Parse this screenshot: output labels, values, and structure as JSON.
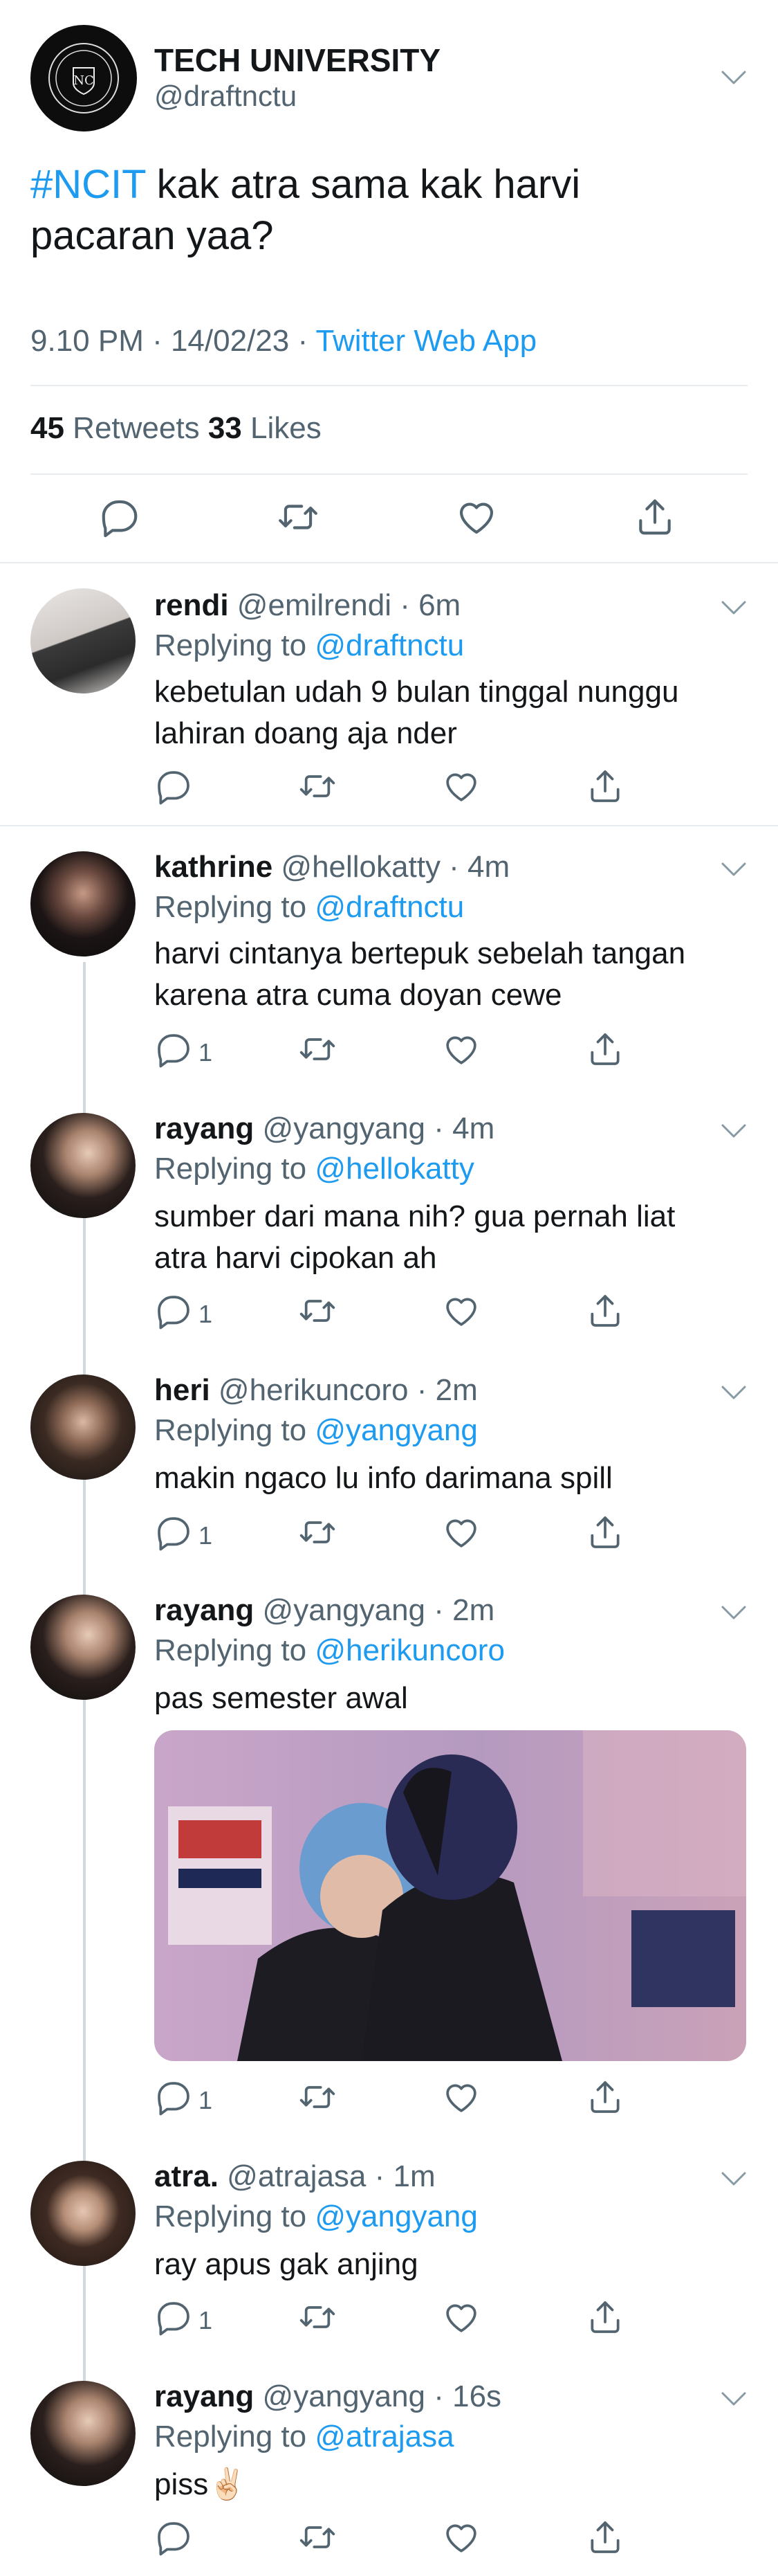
{
  "main": {
    "name": "TECH UNIVERSITY",
    "handle": "@draftnctu",
    "hashtag": "#NCIT",
    "text": " kak atra sama kak harvi pacaran yaa?",
    "time": "9.10 PM · 14/02/23 · ",
    "source": "Twitter Web App",
    "retweets": "45",
    "retweets_label": " Retweets ",
    "likes": "33",
    "likes_label": " Likes"
  },
  "replies": [
    {
      "name": "rendi",
      "handle": " @emilrendi · 6m",
      "replying": "Replying to ",
      "to": "@draftnctu",
      "text": "kebetulan udah 9 bulan tinggal nunggu lahiran doang aja nder",
      "count": ""
    },
    {
      "name": "kathrine",
      "handle": " @hellokatty · 4m",
      "replying": "Replying to ",
      "to": "@draftnctu",
      "text": "harvi cintanya bertepuk sebelah tangan karena atra cuma doyan cewe",
      "count": "1"
    },
    {
      "name": "rayang",
      "handle": " @yangyang · 4m",
      "replying": "Replying to ",
      "to": "@hellokatty",
      "text": "sumber dari mana nih? gua pernah liat atra harvi cipokan ah",
      "count": "1"
    },
    {
      "name": "heri",
      "handle": " @herikuncoro · 2m",
      "replying": "Replying to ",
      "to": "@yangyang",
      "text": "makin ngaco lu info darimana spill",
      "count": "1"
    },
    {
      "name": "rayang",
      "handle": " @yangyang · 2m",
      "replying": "Replying to ",
      "to": "@herikuncoro",
      "text": "pas semester awal",
      "count": "1"
    },
    {
      "name": "atra.",
      "handle": " @atrajasa · 1m",
      "replying": "Replying to ",
      "to": "@yangyang",
      "text": "ray apus gak anjing",
      "count": "1"
    },
    {
      "name": "rayang",
      "handle": " @yangyang · 16s",
      "replying": "Replying to ",
      "to": "@atrajasa",
      "text": "piss✌🏻",
      "count": ""
    }
  ],
  "icons": [
    "logo-seal",
    "reply-icon",
    "retweet-icon",
    "like-icon",
    "share-icon",
    "chevron-down-icon"
  ],
  "colors": {
    "accent": "#1d9bf0",
    "muted": "#536471",
    "divider": "#e6ecf0"
  }
}
